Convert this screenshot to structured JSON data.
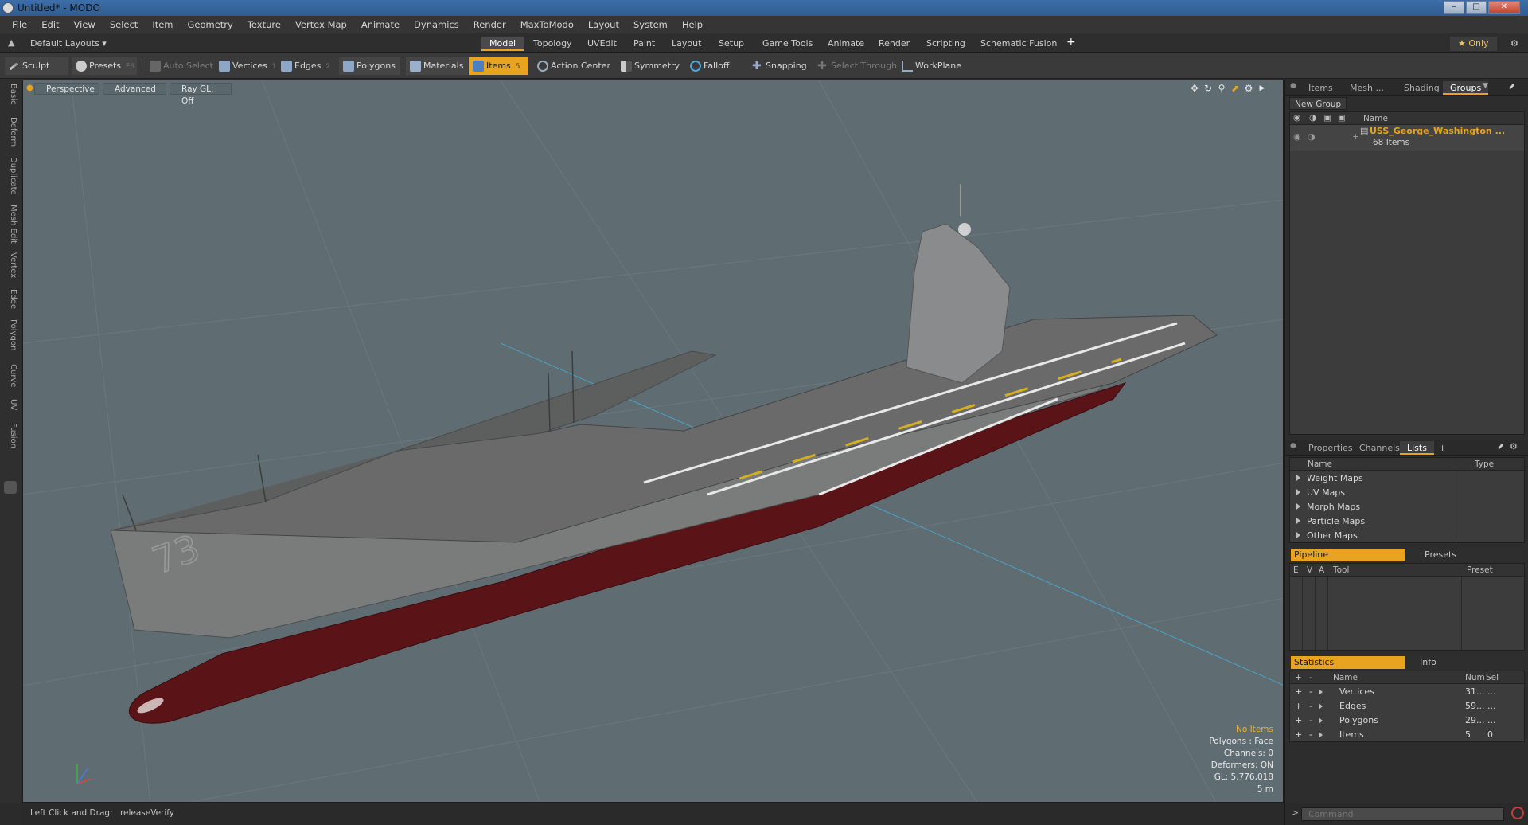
{
  "window": {
    "title": "Untitled* - MODO",
    "controls": [
      "minimize",
      "maximize",
      "close"
    ]
  },
  "menu": [
    "File",
    "Edit",
    "View",
    "Select",
    "Item",
    "Geometry",
    "Texture",
    "Vertex Map",
    "Animate",
    "Dynamics",
    "Render",
    "MaxToModo",
    "Layout",
    "System",
    "Help"
  ],
  "layoutbar": {
    "layout_selector": "Default Layouts ▾",
    "tabs": [
      "Model",
      "Topology",
      "UVEdit",
      "Paint",
      "Layout",
      "Setup",
      "Game Tools",
      "Animate",
      "Render",
      "Scripting",
      "Schematic Fusion"
    ],
    "active_tab": "Model",
    "add": "+",
    "only_label": "★ Only",
    "gear": "⚙"
  },
  "toolbar": {
    "sculpt": "Sculpt",
    "presets": "Presets",
    "presets_key": "F6",
    "auto_select": "Auto Select",
    "vertices": "Vertices",
    "vertices_key": "1",
    "edges": "Edges",
    "edges_key": "2",
    "polygons": "Polygons",
    "materials": "Materials",
    "items": "Items",
    "items_key": "5",
    "action_center": "Action Center",
    "symmetry": "Symmetry",
    "falloff": "Falloff",
    "snapping": "Snapping",
    "select_through": "Select Through",
    "workplane": "WorkPlane"
  },
  "left_tabs": [
    "Basic",
    "Deform",
    "Duplicate",
    "Mesh Edit",
    "Vertex",
    "Edge",
    "Polygon",
    "Curve",
    "UV",
    "Fusion"
  ],
  "viewport": {
    "view": "Perspective",
    "shading": "Advanced",
    "raygl": "Ray GL: Off",
    "stats": {
      "selection": "No Items",
      "polygons": "Polygons : Face",
      "channels": "Channels: 0",
      "deformers": "Deformers: ON",
      "gl": "GL: 5,776,018",
      "scale": "5 m"
    },
    "hull_number": "73"
  },
  "status": {
    "hint_label": "Left Click and Drag:",
    "hint_value": "releaseVerify"
  },
  "right": {
    "top_tabs": [
      "Items",
      "Mesh ...",
      "Shading",
      "Groups"
    ],
    "top_active": "Groups",
    "new_group": "New Group",
    "groups_header": "Name",
    "group_name": "USS_George_Washington ...",
    "group_count": "68 Items",
    "mid_tabs": [
      "Properties",
      "Channels",
      "Lists"
    ],
    "mid_active": "Lists",
    "mid_add": "+",
    "lists_header_name": "Name",
    "lists_header_type": "Type",
    "lists": [
      "Weight Maps",
      "UV Maps",
      "Morph Maps",
      "Particle Maps",
      "Other Maps"
    ],
    "pipeline_tab": "Pipeline",
    "presets_tab": "Presets",
    "pipeline_cols": [
      "E",
      "V",
      "A",
      "Tool",
      "Preset"
    ],
    "statistics_tab": "Statistics",
    "info_tab": "Info",
    "stats_cols": [
      "+",
      "-",
      "Name",
      "Num",
      "Sel"
    ],
    "stats_rows": [
      {
        "name": "Vertices",
        "num": "31...",
        "sel": "..."
      },
      {
        "name": "Edges",
        "num": "59...",
        "sel": "..."
      },
      {
        "name": "Polygons",
        "num": "29...",
        "sel": "..."
      },
      {
        "name": "Items",
        "num": "5",
        "sel": "0"
      }
    ],
    "command_placeholder": "Command"
  },
  "colors": {
    "accent": "#e8a320",
    "viewport_bg": "#5f6d73",
    "hull_red": "#5a1418"
  }
}
